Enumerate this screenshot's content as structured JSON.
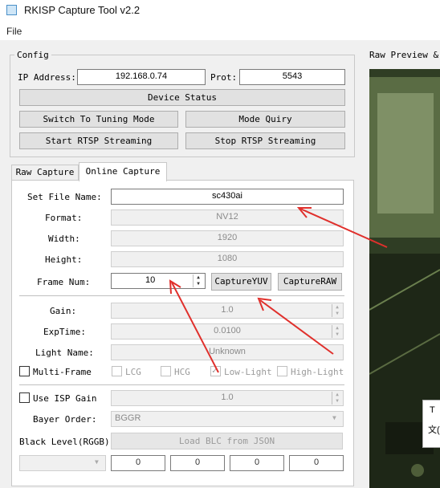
{
  "window": {
    "title": "RKISP Capture Tool v2.2"
  },
  "menu": {
    "file": "File"
  },
  "config": {
    "title": "Config",
    "ip_label": "IP Address:",
    "ip_value": "192.168.0.74",
    "port_label": "Prot:",
    "port_value": "5543",
    "device_status": "Device Status",
    "switch_tuning": "Switch To Tuning Mode",
    "mode_query": "Mode Quiry",
    "start_rtsp": "Start RTSP Streaming",
    "stop_rtsp": "Stop RTSP Streaming"
  },
  "tabs": {
    "raw": "Raw Capture",
    "online": "Online Capture"
  },
  "capture": {
    "file_name_label": "Set File Name:",
    "file_name_value": "sc430ai",
    "format_label": "Format:",
    "format_value": "NV12",
    "width_label": "Width:",
    "width_value": "1920",
    "height_label": "Height:",
    "height_value": "1080",
    "frame_num_label": "Frame Num:",
    "frame_num_value": "10",
    "capture_yuv": "CaptureYUV",
    "capture_raw": "CaptureRAW",
    "gain_label": "Gain:",
    "gain_value": "1.0",
    "exptime_label": "ExpTime:",
    "exptime_value": "0.0100",
    "light_name_label": "Light Name:",
    "light_name_value": "Unknown",
    "multi_frame": "Multi-Frame",
    "lcg": "LCG",
    "hcg": "HCG",
    "low_light": "Low-Light",
    "high_light": "High-Light",
    "use_isp_gain": "Use ISP Gain",
    "isp_gain_value": "1.0",
    "bayer_label": "Bayer Order:",
    "bayer_value": "BGGR",
    "black_level_label": "Black Level(RGGB):",
    "load_blc": "Load BLC from JSON",
    "blc_values": [
      "0",
      "0",
      "0",
      "0"
    ]
  },
  "preview": {
    "title": "Raw Preview & S",
    "popup_t": "T",
    "popup_text": "文("
  },
  "colors": {
    "arrow": "#e0302c",
    "preview_bg": "#2c3a22"
  }
}
